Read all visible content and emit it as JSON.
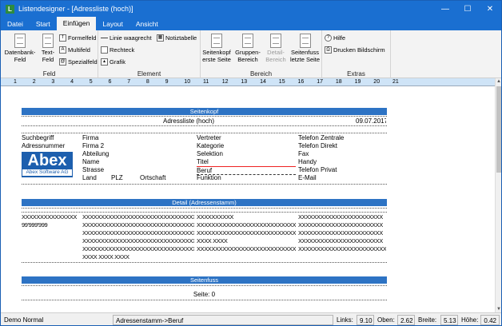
{
  "window": {
    "title": "Listendesigner - [Adressliste (hoch)]",
    "app_icon": "L"
  },
  "menu": {
    "tabs": [
      "Datei",
      "Start",
      "Einfügen",
      "Layout",
      "Ansicht"
    ]
  },
  "ribbon": {
    "feld": {
      "label": "Feld",
      "datenbankfeld": "Datenbank-\nFeld",
      "textfeld": "Text-\nFeld",
      "formelfeld": "Formelfeld",
      "multifeld": "Multifeld",
      "spezialfeld": "Spezialfeld"
    },
    "element": {
      "label": "Element",
      "linie": "Linie waagrecht",
      "notiztabelle": "Notiztabelle",
      "rechteck": "Rechteck",
      "grafik": "Grafik"
    },
    "bereich": {
      "label": "Bereich",
      "seitenkopf": "Seitenkopf\nerste Seite",
      "gruppenbereich": "Gruppen-\nBereich",
      "detailbereich": "Detail-\nBereich",
      "seitenfuss": "Seitenfuss\nletzte Seite"
    },
    "extras": {
      "label": "Extras",
      "hilfe": "Hilfe",
      "drucken": "Drucken Bildschirm"
    }
  },
  "ruler": {
    "ticks": [
      "1",
      "2",
      "3",
      "4",
      "5",
      "6",
      "7",
      "8",
      "9",
      "10",
      "11",
      "12",
      "13",
      "14",
      "15",
      "16",
      "17",
      "18",
      "19",
      "20",
      "21"
    ]
  },
  "report": {
    "seitenkopf": "Seitenkopf",
    "title_field": "Adressliste (hoch)",
    "date_field": "09.07.2017",
    "col1": [
      "Suchbegriff",
      "Adressnummer"
    ],
    "col2": [
      "Firma",
      "Firma 2",
      "Abteilung",
      "Name",
      "Strasse",
      "Land",
      "PLZ",
      "Ortschaft"
    ],
    "col3": [
      "Vertreter",
      "Kategorie",
      "Selektion",
      "Titel",
      "Beruf",
      "Funktion"
    ],
    "col4": [
      "Telefon Zentrale",
      "Telefon Direkt",
      "Fax",
      "Handy",
      "Telefon Privat",
      "E-Mail"
    ],
    "logo": {
      "text": "Abex",
      "subtext": "Abex Software AG"
    },
    "detail": "Detail (Adressenstamm)",
    "detail_col1": [
      "XXXXXXXXXXXXXXX",
      "99'999'999"
    ],
    "detail_col2": [
      "XXXXXXXXXXXXXXXXXXXXXXXXXXXXXXXXXXXX",
      "XXXXXXXXXXXXXXXXXXXXXXXXXXXXXXXXXXXX",
      "XXXXXXXXXXXXXXXXXXXXXXXXXXXXXXXXXXXX",
      "XXXXXXXXXXXXXXXXXXXXXXXXXXXXXXXXXXXX",
      "XXXXXXXXXXXXXXXXXXXXXXXXXXXXXXXXXXXX",
      "XXXX XXXX XXXX"
    ],
    "detail_col3": [
      "XXXXXXXXXX",
      "XXXXXXXXXXXXXXXXXXXXXXXXXXXXXXXX",
      "XXXXXXXXXXXXXXXXXXXXXXXXXXXXXXXX",
      "XXXX XXXX",
      "XXXXXXXXXXXXXXXXXXXXXXXXXXXXXXXX"
    ],
    "detail_col4": [
      "XXXXXXXXXXXXXXXXXXXXXXX",
      "XXXXXXXXXXXXXXXXXXXXXXX",
      "XXXXXXXXXXXXXXXXXXXXXXX",
      "XXXXXXXXXXXXXXXXXXXXXXX",
      "XXXXXXXXXXXXXXXXXXXXXXXXXXXXX"
    ],
    "seitenfuss": "Seitenfuss",
    "page_field": "Seite: 0"
  },
  "status": {
    "mode": "Demo Normal",
    "path": "Adressenstamm->Beruf",
    "links_label": "Links:",
    "links": "9.10",
    "oben_label": "Oben:",
    "oben": "2.62",
    "breite_label": "Breite:",
    "breite": "5.13",
    "hoehe_label": "Höhe:",
    "hoehe": "0.42"
  }
}
